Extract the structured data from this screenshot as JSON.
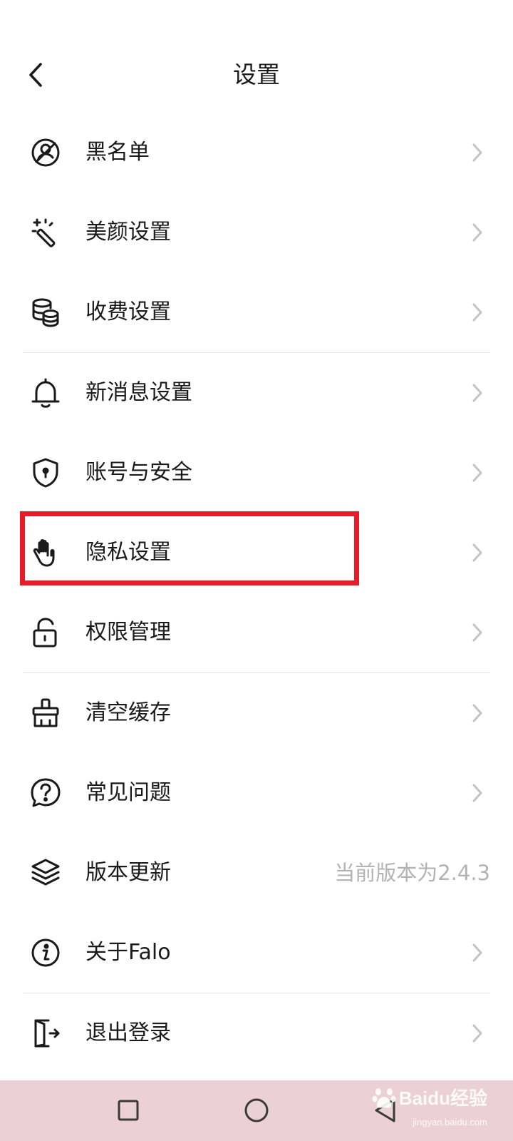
{
  "header": {
    "title": "设置"
  },
  "settings": {
    "items": [
      {
        "label": "黑名单",
        "icon": "blacklist-icon"
      },
      {
        "label": "美颜设置",
        "icon": "magic-wand-icon"
      },
      {
        "label": "收费设置",
        "icon": "coins-icon"
      },
      {
        "label": "新消息设置",
        "icon": "bell-icon"
      },
      {
        "label": "账号与安全",
        "icon": "shield-icon"
      },
      {
        "label": "隐私设置",
        "icon": "hand-icon"
      },
      {
        "label": "权限管理",
        "icon": "unlock-icon"
      },
      {
        "label": "清空缓存",
        "icon": "broom-icon"
      },
      {
        "label": "常见问题",
        "icon": "question-icon"
      },
      {
        "label": "版本更新",
        "icon": "layers-icon",
        "value": "当前版本为2.4.3"
      },
      {
        "label": "关于Falo",
        "icon": "info-icon"
      },
      {
        "label": "退出登录",
        "icon": "logout-icon"
      }
    ]
  },
  "annotation": {
    "highlight_color": "#e51d2b",
    "highlighted_item": "隐私设置"
  },
  "watermark": {
    "brand": "Baidu经验",
    "url": "jingyan.baidu.com"
  },
  "colors": {
    "text": "#1a1a1a",
    "secondary_text": "#b3b3b3",
    "divider": "#e6e6e6",
    "navbar_bg": "#ebd0d6"
  }
}
